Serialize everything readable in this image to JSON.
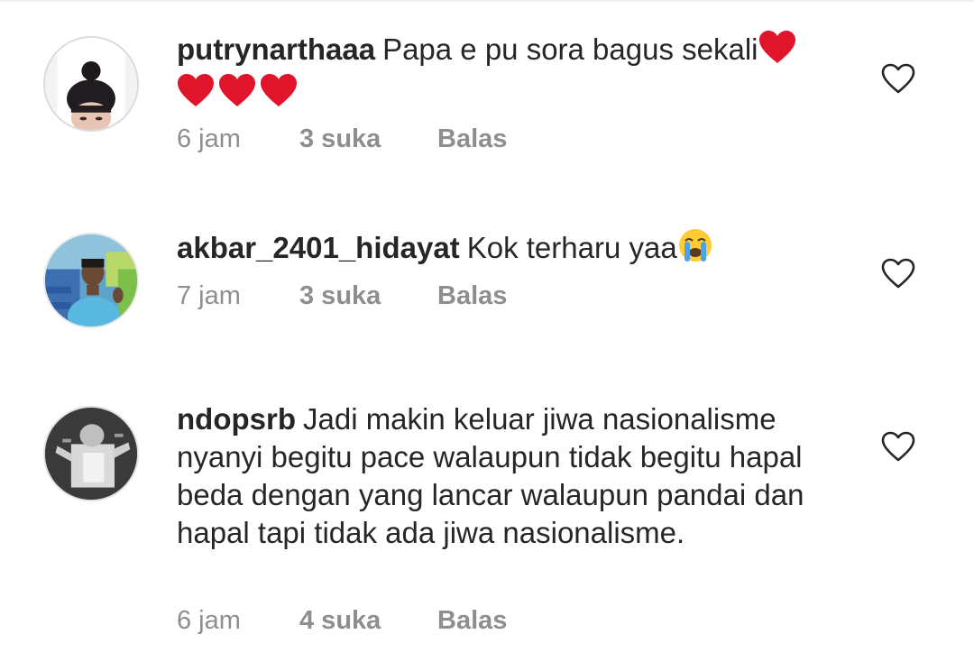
{
  "comments": [
    {
      "username": "putrynarthaaa",
      "text": "Papa e pu sora bagus sekali",
      "emoji_after": [
        "red-heart-icon",
        "red-heart-icon",
        "red-heart-icon",
        "red-heart-icon"
      ],
      "time": "6 jam",
      "likes": "3 suka",
      "reply_label": "Balas",
      "like_icon": "heart-outline-icon"
    },
    {
      "username": "akbar_2401_hidayat",
      "text": "Kok terharu yaa",
      "emoji_after": [
        "loudly-crying-face-icon"
      ],
      "time": "7 jam",
      "likes": "3 suka",
      "reply_label": "Balas",
      "like_icon": "heart-outline-icon"
    },
    {
      "username": "ndopsrb",
      "text": "Jadi makin keluar jiwa nasionalisme nyanyi begitu pace walaupun tidak begitu hapal beda dengan yang lancar walaupun pandai dan hapal tapi tidak ada jiwa nasionalisme.",
      "emoji_after": [],
      "time": "6 jam",
      "likes": "4 suka",
      "reply_label": "Balas",
      "like_icon": "heart-outline-icon"
    }
  ],
  "colors": {
    "text_primary": "#262626",
    "text_secondary": "#8e8e8e",
    "heart_red": "#e0152b",
    "divider": "#efefef"
  }
}
